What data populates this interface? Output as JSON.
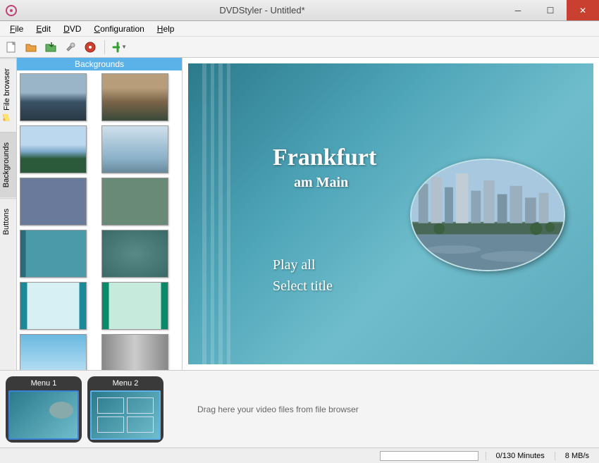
{
  "window": {
    "title": "DVDStyler - Untitled*"
  },
  "menubar": {
    "items": [
      "File",
      "Edit",
      "DVD",
      "Configuration",
      "Help"
    ]
  },
  "toolbar": {
    "icons": [
      "new-doc-icon",
      "open-folder-icon",
      "save-icon",
      "settings-icon",
      "burn-disc-icon",
      "add-icon"
    ]
  },
  "sidetabs": {
    "items": [
      {
        "label": "File browser",
        "active": false
      },
      {
        "label": "Backgrounds",
        "active": true
      },
      {
        "label": "Buttons",
        "active": false
      }
    ]
  },
  "browser": {
    "header": "Backgrounds",
    "thumb_count": 12
  },
  "canvas": {
    "title_main": "Frankfurt",
    "title_sub": "am Main",
    "button1": "Play all",
    "button2": "Select title"
  },
  "timeline": {
    "menus": [
      {
        "label": "Menu 1",
        "selected": true
      },
      {
        "label": "Menu 2",
        "selected": false
      }
    ],
    "drophint": "Drag here your video files from file browser"
  },
  "statusbar": {
    "duration": "0/130 Minutes",
    "rate": "8 MB/s"
  }
}
